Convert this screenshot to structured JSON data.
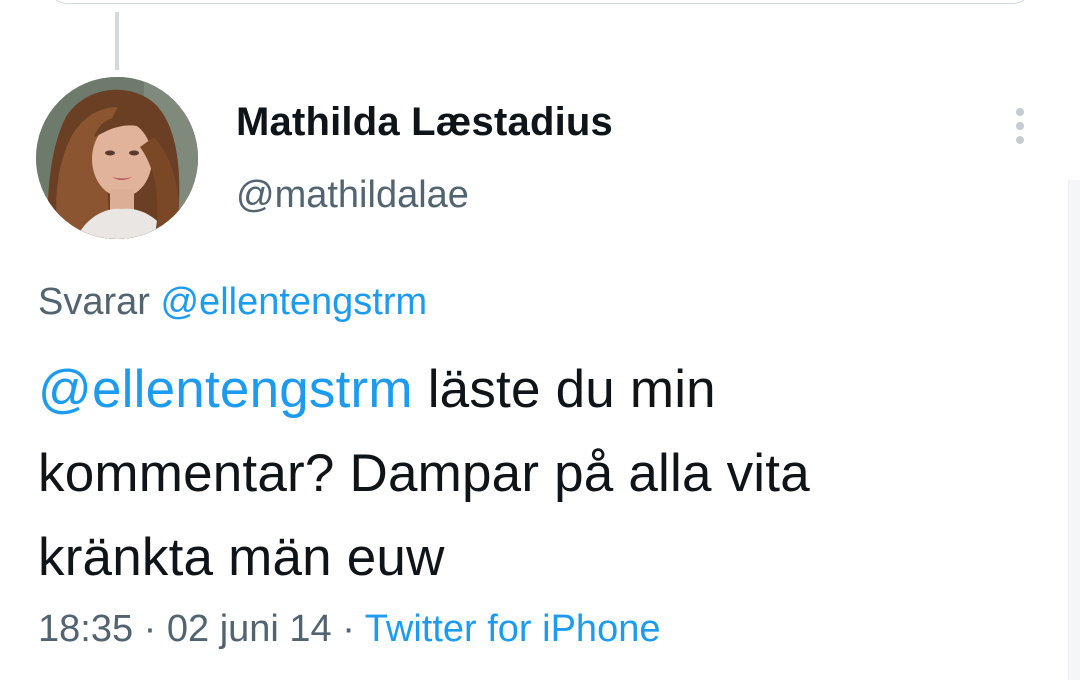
{
  "tweet": {
    "author": {
      "display_name": "Mathilda Læstadius",
      "handle": "@mathildalae"
    },
    "reply": {
      "prefix": "Svarar",
      "to": "@ellentengstrm"
    },
    "text": {
      "mention": "@ellentengstrm",
      "line1_rest": " läste du min",
      "line2": "kommentar? Dampar på alla vita",
      "line3": "kränkta män euw"
    },
    "meta": {
      "time": "18:35",
      "separator1": " · ",
      "date": "02 juni 14",
      "separator2": " · ",
      "source": "Twitter for iPhone"
    }
  },
  "icons": {
    "more": "more-vertical-icon"
  },
  "colors": {
    "link": "#1d9bf0",
    "secondary_text": "#536471",
    "primary_text": "#0f1419",
    "divider": "#cfd9de"
  }
}
